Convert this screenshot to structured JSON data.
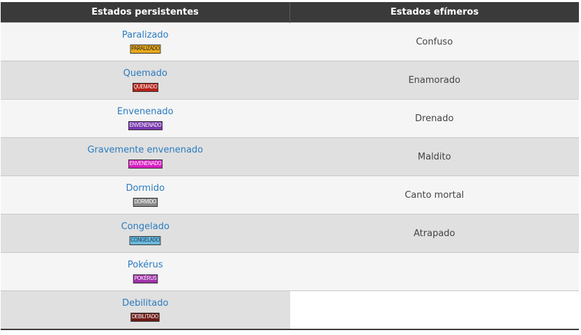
{
  "table": {
    "headers": [
      "Estados persistentes",
      "Estados efímeros"
    ],
    "rows": [
      {
        "persistent": "Paralizado",
        "badge": "PARALIZADO",
        "badge_bg": "#e8a91c",
        "badge_fg": "#222222",
        "ephemeral": "Confuso"
      },
      {
        "persistent": "Quemado",
        "badge": "QUEMADO",
        "badge_bg": "#b52218",
        "badge_fg": "#ffffff",
        "ephemeral": "Enamorado"
      },
      {
        "persistent": "Envenenado",
        "badge": "ENVENENADO",
        "badge_bg": "#7a3ab0",
        "badge_fg": "#ffffff",
        "ephemeral": "Drenado"
      },
      {
        "persistent": "Gravemente envenenado",
        "badge": "ENVENENADO",
        "badge_bg": "#d81fc2",
        "badge_fg": "#ffffff",
        "ephemeral": "Maldito"
      },
      {
        "persistent": "Dormido",
        "badge": "DORMIDO",
        "badge_bg": "#8a8a8a",
        "badge_fg": "#ffffff",
        "ephemeral": "Canto mortal"
      },
      {
        "persistent": "Congelado",
        "badge": "CONGELADO",
        "badge_bg": "#6cb8dc",
        "badge_fg": "#123a55",
        "ephemeral": "Atrapado"
      },
      {
        "persistent": "Pokérus",
        "badge": "POKÉRUS",
        "badge_bg": "#a030a8",
        "badge_fg": "#ffffff",
        "ephemeral": ""
      },
      {
        "persistent": "Debilitado",
        "badge": "DEBILITADO",
        "badge_bg": "#6e1a16",
        "badge_fg": "#ffffff",
        "ephemeral": ""
      }
    ]
  }
}
